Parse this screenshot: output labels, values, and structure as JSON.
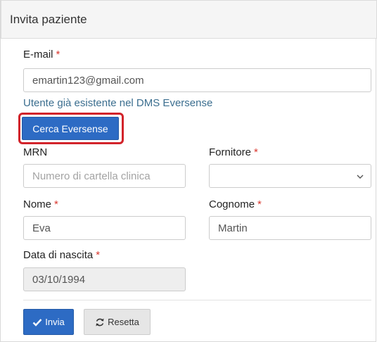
{
  "panel": {
    "title": "Invita paziente"
  },
  "form": {
    "email": {
      "label": "E-mail",
      "required_mark": "*",
      "value": "emartin123@gmail.com"
    },
    "existing_user_hint": "Utente già esistente nel DMS Eversense",
    "search_button": "Cerca Eversense",
    "mrn": {
      "label": "MRN",
      "placeholder": "Numero di cartella clinica"
    },
    "provider": {
      "label": "Fornitore",
      "required_mark": "*",
      "value": ""
    },
    "first_name": {
      "label": "Nome",
      "required_mark": "*",
      "value": "Eva"
    },
    "last_name": {
      "label": "Cognome",
      "required_mark": "*",
      "value": "Martin"
    },
    "birth_date": {
      "label": "Data di nascita",
      "required_mark": "*",
      "value": "03/10/1994"
    }
  },
  "actions": {
    "submit_label": "Invia",
    "reset_label": "Resetta"
  },
  "colors": {
    "primary": "#2d6bc4",
    "required": "#d9382f",
    "highlight": "#d2232a",
    "hint": "#3b6e8f"
  },
  "icons": {
    "submit": "check-icon",
    "reset": "refresh-icon",
    "select": "chevron-down-icon"
  }
}
